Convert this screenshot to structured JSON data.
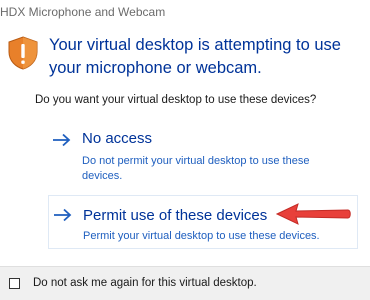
{
  "window": {
    "title": "HDX Microphone and Webcam"
  },
  "dialog": {
    "headline": "Your virtual desktop is attempting to use your microphone or webcam.",
    "question": "Do you want your virtual desktop to use these devices?",
    "options": [
      {
        "label": "No access",
        "description": "Do not permit your virtual desktop to use these devices."
      },
      {
        "label": "Permit use of these devices",
        "description": "Permit your virtual desktop to use these devices."
      }
    ]
  },
  "footer": {
    "checkbox_label": "Do not ask me again for this virtual desktop.",
    "checked": false
  },
  "colors": {
    "headline": "#003399",
    "link": "#1f5fbf",
    "highlight_arrow": "#e8403a",
    "footer_bg": "#f0f0f0"
  },
  "icons": {
    "shield": "warning-shield-icon",
    "option_arrow": "right-arrow-icon",
    "annotation": "red-pointer-arrow-icon"
  }
}
